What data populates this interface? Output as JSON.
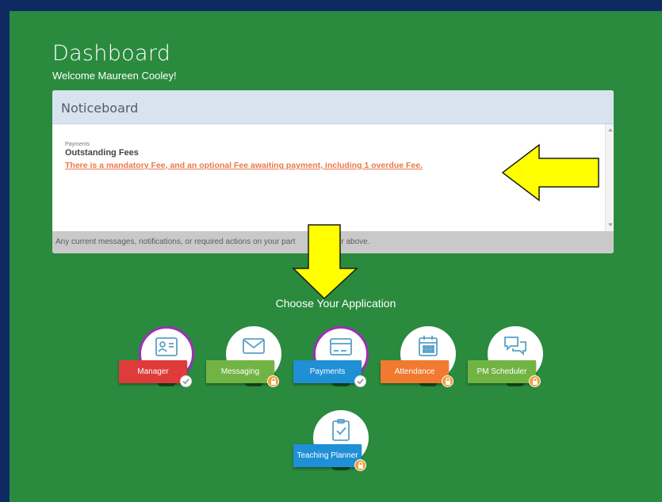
{
  "page": {
    "title": "Dashboard",
    "welcome": "Welcome Maureen Cooley!"
  },
  "noticeboard": {
    "header": "Noticeboard",
    "category": "Payments",
    "title": "Outstanding Fees",
    "link": "There is a mandatory Fee, and an optional Fee awaiting payment, including 1 overdue Fee.",
    "footer_before": "Any current messages, notifications, or required actions on your part",
    "footer_after": "r above."
  },
  "apps": {
    "heading": "Choose Your Application",
    "items": [
      {
        "label": "Manager",
        "color": "#e03b3b",
        "icon": "id-card-icon",
        "status": "check",
        "active": true
      },
      {
        "label": "Messaging",
        "color": "#72b444",
        "icon": "envelope-icon",
        "status": "lock",
        "active": false
      },
      {
        "label": "Payments",
        "color": "#1f8fd6",
        "icon": "credit-card-icon",
        "status": "check",
        "active": true
      },
      {
        "label": "Attendance",
        "color": "#f07a30",
        "icon": "calendar-icon",
        "status": "lock",
        "active": false
      },
      {
        "label": "PM Scheduler",
        "color": "#72b444",
        "icon": "chat-bubbles-icon",
        "status": "lock",
        "active": false
      },
      {
        "label": "Teaching Planner",
        "color": "#1f8fd6",
        "icon": "clipboard-check-icon",
        "status": "lock",
        "active": false
      }
    ]
  },
  "colors": {
    "background": "#2a8a3e",
    "border": "#0e2a63",
    "link": "#e8794b",
    "arrow": "#ffff00"
  }
}
